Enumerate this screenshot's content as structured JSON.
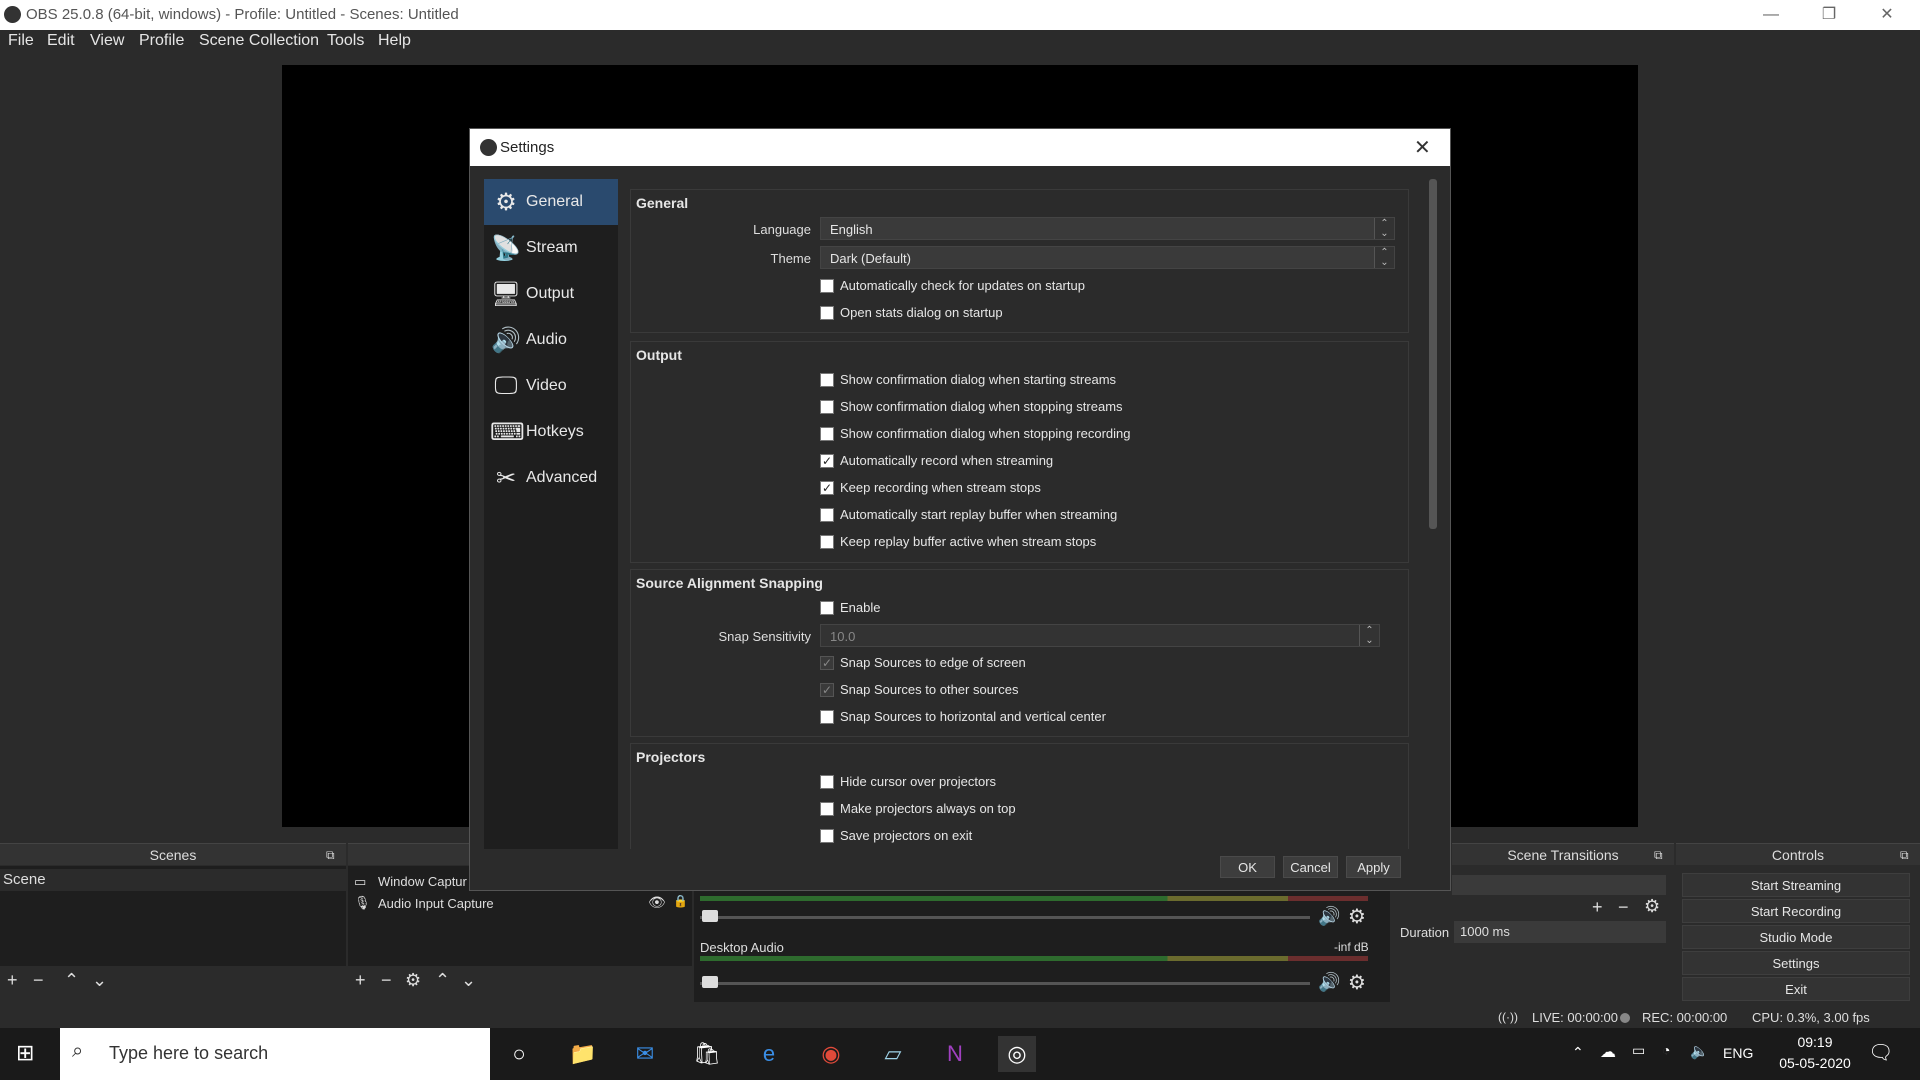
{
  "window": {
    "title": "OBS 25.0.8 (64-bit, windows) - Profile: Untitled - Scenes: Untitled",
    "controls": {
      "minimize": "—",
      "restore": "❐",
      "close": "✕"
    }
  },
  "menubar": {
    "items": [
      "File",
      "Edit",
      "View",
      "Profile",
      "Scene Collection",
      "Tools",
      "Help"
    ]
  },
  "docks": {
    "scenes": {
      "title": "Scenes",
      "items": [
        "Scene"
      ]
    },
    "sources": {
      "items": [
        "Window Captur",
        "Audio Input Capture"
      ]
    },
    "mixer": {
      "desktop_audio": {
        "name": "Desktop Audio",
        "level": "-inf dB"
      },
      "scale": [
        "-60",
        "-55",
        "-50",
        "-45",
        "-40",
        "-35",
        "-30",
        "-25",
        "-20",
        "-15",
        "-10",
        "-5",
        "0"
      ]
    },
    "transitions": {
      "title": "Scene Transitions",
      "duration_label": "Duration",
      "duration_value": "1000 ms"
    },
    "controls": {
      "title": "Controls",
      "buttons": [
        "Start Streaming",
        "Start Recording",
        "Studio Mode",
        "Settings",
        "Exit"
      ]
    }
  },
  "statusbar": {
    "live": "LIVE: 00:00:00",
    "rec": "REC: 00:00:00",
    "cpu": "CPU: 0.3%, 3.00 fps"
  },
  "settings": {
    "title": "Settings",
    "close": "✕",
    "sidebar": [
      {
        "label": "General",
        "icon": "gear-icon",
        "glyph": "⚙",
        "selected": true
      },
      {
        "label": "Stream",
        "icon": "antenna-icon",
        "glyph": "📡",
        "selected": false
      },
      {
        "label": "Output",
        "icon": "monitor-arrow-icon",
        "glyph": "🖥",
        "selected": false
      },
      {
        "label": "Audio",
        "icon": "speaker-icon",
        "glyph": "🔊",
        "selected": false
      },
      {
        "label": "Video",
        "icon": "monitor-icon",
        "glyph": "🖵",
        "selected": false
      },
      {
        "label": "Hotkeys",
        "icon": "keyboard-icon",
        "glyph": "⌨",
        "selected": false
      },
      {
        "label": "Advanced",
        "icon": "tools-icon",
        "glyph": "✂",
        "selected": false
      }
    ],
    "general": {
      "title": "General",
      "language_label": "Language",
      "language_value": "English",
      "theme_label": "Theme",
      "theme_value": "Dark (Default)",
      "checks": [
        {
          "label": "Automatically check for updates on startup",
          "checked": false
        },
        {
          "label": "Open stats dialog on startup",
          "checked": false
        }
      ]
    },
    "output": {
      "title": "Output",
      "checks": [
        {
          "label": "Show confirmation dialog when starting streams",
          "checked": false
        },
        {
          "label": "Show confirmation dialog when stopping streams",
          "checked": false
        },
        {
          "label": "Show confirmation dialog when stopping recording",
          "checked": false
        },
        {
          "label": "Automatically record when streaming",
          "checked": true
        },
        {
          "label": "Keep recording when stream stops",
          "checked": true
        },
        {
          "label": "Automatically start replay buffer when streaming",
          "checked": false
        },
        {
          "label": "Keep replay buffer active when stream stops",
          "checked": false
        }
      ]
    },
    "snapping": {
      "title": "Source Alignment Snapping",
      "enable": {
        "label": "Enable",
        "checked": false
      },
      "sensitivity_label": "Snap Sensitivity",
      "sensitivity_value": "10.0",
      "checks": [
        {
          "label": "Snap Sources to edge of screen",
          "checked": true,
          "disabled": true
        },
        {
          "label": "Snap Sources to other sources",
          "checked": true,
          "disabled": true
        },
        {
          "label": "Snap Sources to horizontal and vertical center",
          "checked": false,
          "disabled": false
        }
      ]
    },
    "projectors": {
      "title": "Projectors",
      "checks": [
        {
          "label": "Hide cursor over projectors",
          "checked": false
        },
        {
          "label": "Make projectors always on top",
          "checked": false
        },
        {
          "label": "Save projectors on exit",
          "checked": false
        }
      ]
    },
    "buttons": {
      "ok": "OK",
      "cancel": "Cancel",
      "apply": "Apply"
    }
  },
  "taskbar": {
    "search_placeholder": "Type here to search",
    "apps": [
      "task-view-icon",
      "file-explorer-icon",
      "mail-icon",
      "store-icon",
      "edge-icon",
      "chrome-icon",
      "notepad-icon",
      "onenote-icon",
      "obs-icon"
    ],
    "lang": "ENG",
    "time": "09:19",
    "date": "05-05-2020"
  }
}
